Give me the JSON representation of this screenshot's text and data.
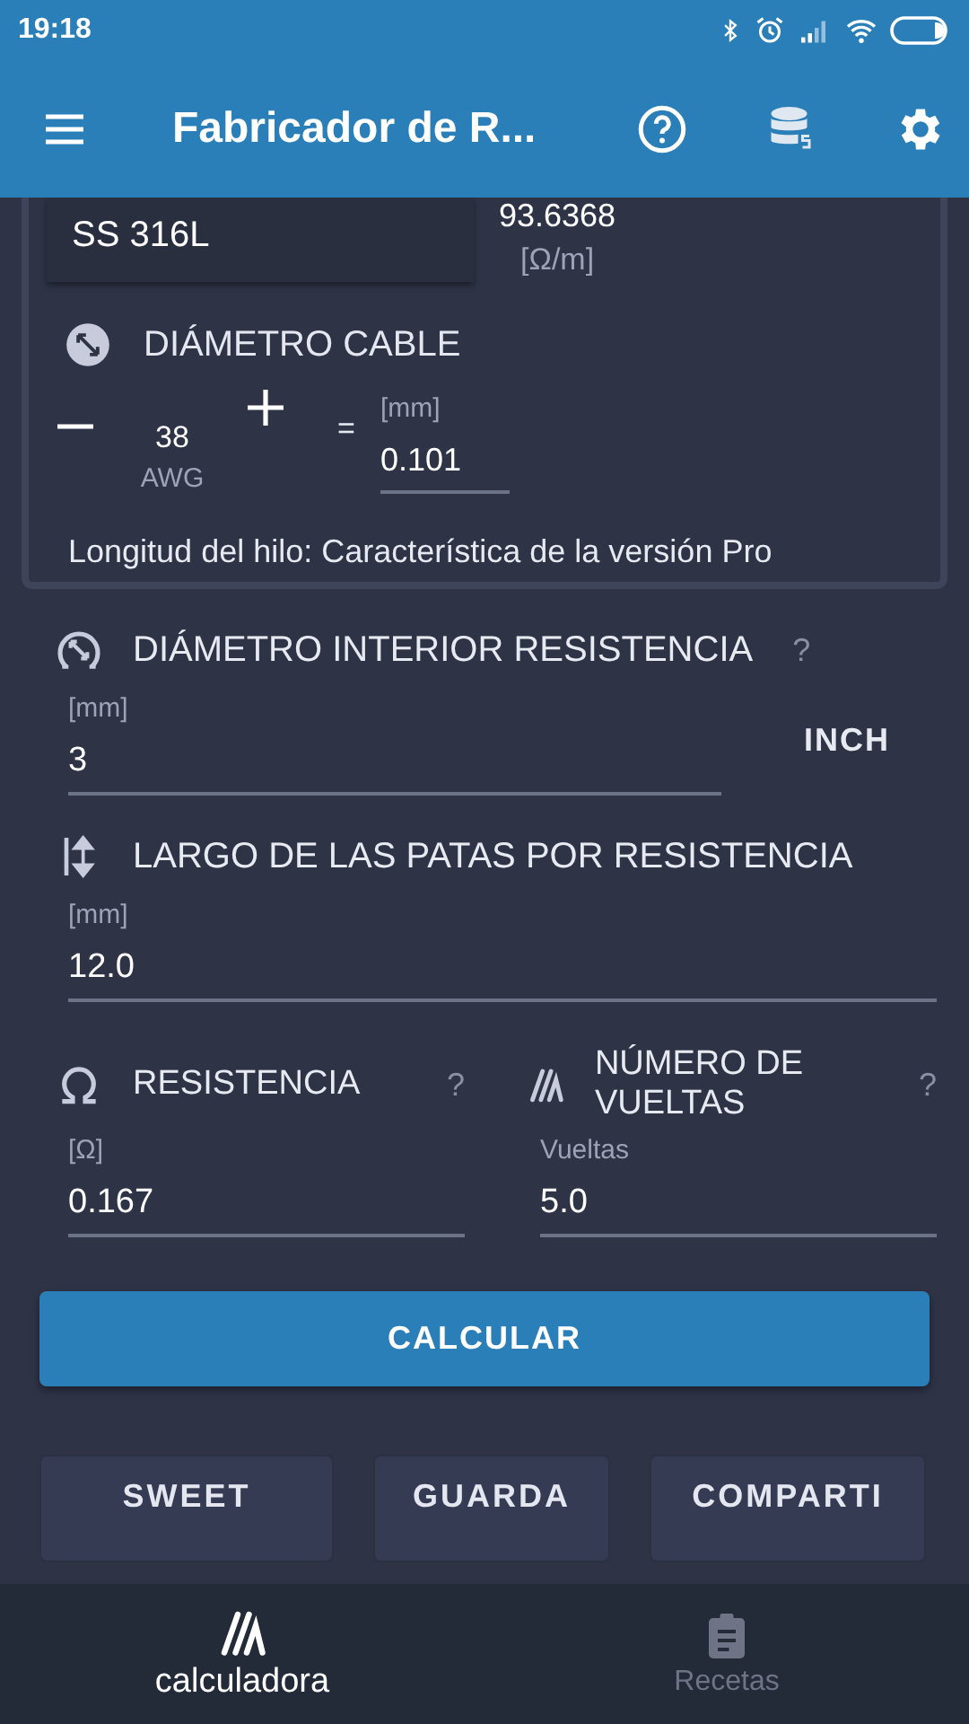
{
  "status_bar": {
    "time": "19:18"
  },
  "app_bar": {
    "title": "Fabricador de R..."
  },
  "wire_card": {
    "material": "SS 316L",
    "resistance_value": "93.6368",
    "resistance_unit": "[Ω/m]",
    "diameter": {
      "title": "DIÁMETRO CABLE",
      "gauge": "38",
      "gauge_unit": "AWG",
      "equals": "=",
      "unit": "[mm]",
      "value": "0.101"
    },
    "note": "Longitud del hilo: Característica de la versión Pro"
  },
  "inner_diameter": {
    "title": "DIÁMETRO INTERIOR RESISTENCIA",
    "help": "?",
    "unit": "[mm]",
    "value": "3",
    "unit_button": "INCH"
  },
  "leg_length": {
    "title": "LARGO DE LAS PATAS POR RESISTENCIA",
    "unit": "[mm]",
    "value": "12.0"
  },
  "resistance": {
    "title": "RESISTENCIA",
    "help": "?",
    "unit": "[Ω]",
    "value": "0.167"
  },
  "turns": {
    "title": "NÚMERO DE VUELTAS",
    "help": "?",
    "unit": "Vueltas",
    "value": "5.0"
  },
  "calculate_button": "CALCULAR",
  "actions": [
    "SWEET",
    "GUARDA",
    "COMPARTI"
  ],
  "nav": [
    {
      "label": "calculadora",
      "selected": true,
      "kind": "coil"
    },
    {
      "label": "Recetas",
      "selected": false,
      "kind": "clipboard"
    }
  ]
}
